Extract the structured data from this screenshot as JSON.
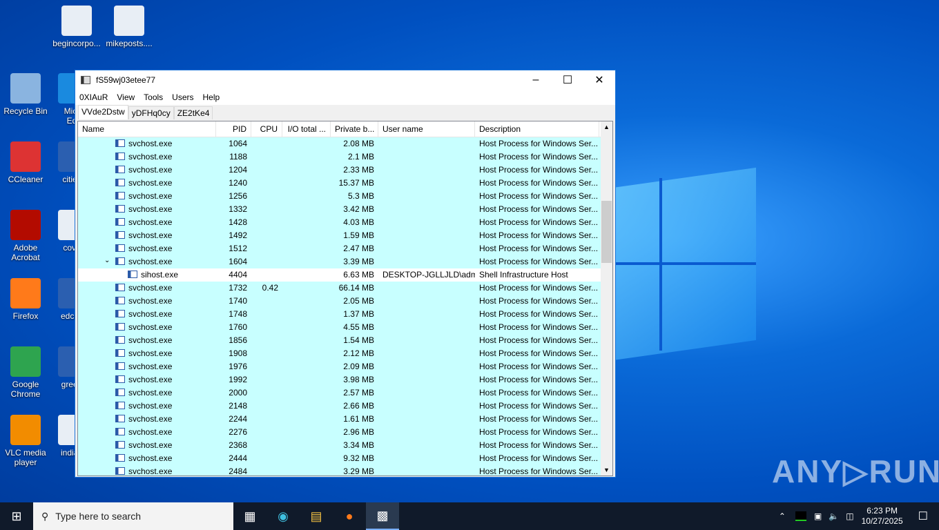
{
  "desktop": {
    "icons": [
      {
        "label": "begincorpo...",
        "color": "#e8eef5"
      },
      {
        "label": "mikeposts....",
        "color": "#e8eef5"
      },
      {
        "label": "Recycle Bin",
        "color": "#8ab4e0"
      },
      {
        "label": "Micr Ed",
        "color": "#1a8adf"
      },
      {
        "label": "CCleaner",
        "color": "#d33"
      },
      {
        "label": "cities",
        "color": "#2b5fb0"
      },
      {
        "label": "Adobe Acrobat",
        "color": "#b30b00"
      },
      {
        "label": "cove",
        "color": "#e8eef5"
      },
      {
        "label": "Firefox",
        "color": "#ff7a1a"
      },
      {
        "label": "edcus",
        "color": "#2b5fb0"
      },
      {
        "label": "Google Chrome",
        "color": "#2ea44f"
      },
      {
        "label": "green",
        "color": "#2b5fb0"
      },
      {
        "label": "VLC media player",
        "color": "#f28c00"
      },
      {
        "label": "indian",
        "color": "#e8eef5"
      }
    ]
  },
  "window": {
    "title": "fS59wj03etee77",
    "menu": [
      "0XIAuR",
      "View",
      "Tools",
      "Users",
      "Help"
    ],
    "tabs": [
      "VVde2Dstw",
      "yDFHq0cy",
      "ZE2tKe4"
    ],
    "columns": [
      "Name",
      "PID",
      "CPU",
      "I/O total ...",
      "Private b...",
      "User name",
      "Description"
    ],
    "rows": [
      [
        "svchost.exe",
        "1064",
        "",
        "",
        "2.08 MB",
        "",
        "Host Process for Windows Ser..."
      ],
      [
        "svchost.exe",
        "1188",
        "",
        "",
        "2.1 MB",
        "",
        "Host Process for Windows Ser..."
      ],
      [
        "svchost.exe",
        "1204",
        "",
        "",
        "2.33 MB",
        "",
        "Host Process for Windows Ser..."
      ],
      [
        "svchost.exe",
        "1240",
        "",
        "",
        "15.37 MB",
        "",
        "Host Process for Windows Ser..."
      ],
      [
        "svchost.exe",
        "1256",
        "",
        "",
        "5.3 MB",
        "",
        "Host Process for Windows Ser..."
      ],
      [
        "svchost.exe",
        "1332",
        "",
        "",
        "3.42 MB",
        "",
        "Host Process for Windows Ser..."
      ],
      [
        "svchost.exe",
        "1428",
        "",
        "",
        "4.03 MB",
        "",
        "Host Process for Windows Ser..."
      ],
      [
        "svchost.exe",
        "1492",
        "",
        "",
        "1.59 MB",
        "",
        "Host Process for Windows Ser..."
      ],
      [
        "svchost.exe",
        "1512",
        "",
        "",
        "2.47 MB",
        "",
        "Host Process for Windows Ser..."
      ],
      [
        "svchost.exe",
        "1604",
        "",
        "",
        "3.39 MB",
        "",
        "Host Process for Windows Ser..."
      ],
      [
        "sihost.exe",
        "4404",
        "",
        "",
        "6.63 MB",
        "DESKTOP-JGLLJLD\\admi",
        "Shell Infrastructure Host"
      ],
      [
        "svchost.exe",
        "1732",
        "0.42",
        "",
        "66.14 MB",
        "",
        "Host Process for Windows Ser..."
      ],
      [
        "svchost.exe",
        "1740",
        "",
        "",
        "2.05 MB",
        "",
        "Host Process for Windows Ser..."
      ],
      [
        "svchost.exe",
        "1748",
        "",
        "",
        "1.37 MB",
        "",
        "Host Process for Windows Ser..."
      ],
      [
        "svchost.exe",
        "1760",
        "",
        "",
        "4.55 MB",
        "",
        "Host Process for Windows Ser..."
      ],
      [
        "svchost.exe",
        "1856",
        "",
        "",
        "1.54 MB",
        "",
        "Host Process for Windows Ser..."
      ],
      [
        "svchost.exe",
        "1908",
        "",
        "",
        "2.12 MB",
        "",
        "Host Process for Windows Ser..."
      ],
      [
        "svchost.exe",
        "1976",
        "",
        "",
        "2.09 MB",
        "",
        "Host Process for Windows Ser..."
      ],
      [
        "svchost.exe",
        "1992",
        "",
        "",
        "3.98 MB",
        "",
        "Host Process for Windows Ser..."
      ],
      [
        "svchost.exe",
        "2000",
        "",
        "",
        "2.57 MB",
        "",
        "Host Process for Windows Ser..."
      ],
      [
        "svchost.exe",
        "2148",
        "",
        "",
        "2.66 MB",
        "",
        "Host Process for Windows Ser..."
      ],
      [
        "svchost.exe",
        "2244",
        "",
        "",
        "1.61 MB",
        "",
        "Host Process for Windows Ser..."
      ],
      [
        "svchost.exe",
        "2276",
        "",
        "",
        "2.96 MB",
        "",
        "Host Process for Windows Ser..."
      ],
      [
        "svchost.exe",
        "2368",
        "",
        "",
        "3.34 MB",
        "",
        "Host Process for Windows Ser..."
      ],
      [
        "svchost.exe",
        "2444",
        "",
        "",
        "9.32 MB",
        "",
        "Host Process for Windows Ser..."
      ],
      [
        "svchost.exe",
        "2484",
        "",
        "",
        "3.29 MB",
        "",
        "Host Process for Windows Ser..."
      ]
    ],
    "expanded_row": 9,
    "child_row": 10
  },
  "taskbar": {
    "search_placeholder": "Type here to search",
    "time": "6:23 PM",
    "date": "10/27/2025"
  },
  "watermark": "ANY▷RUN"
}
